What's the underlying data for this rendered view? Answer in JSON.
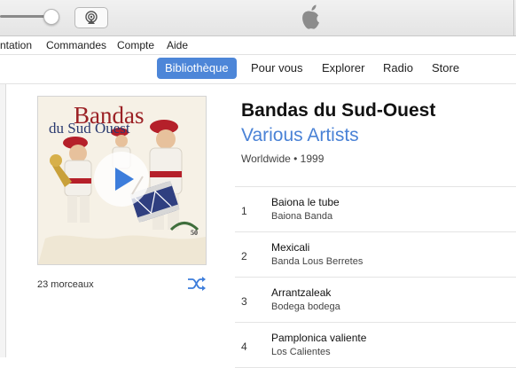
{
  "menu": {
    "items": [
      "ntation",
      "Commandes",
      "Compte",
      "Aide"
    ]
  },
  "nav": {
    "tabs": [
      "Bibliothèque",
      "Pour vous",
      "Explorer",
      "Radio",
      "Store"
    ],
    "active": "Bibliothèque"
  },
  "album": {
    "title": "Bandas du Sud-Ouest",
    "artist": "Various Artists",
    "meta": "Worldwide • 1999",
    "track_count": "23 morceaux",
    "cover_text": {
      "line1": "Bandas",
      "line2": "du Sud Ouest"
    }
  },
  "tracks": [
    {
      "num": "1",
      "name": "Baiona le tube",
      "artist": "Baiona Banda"
    },
    {
      "num": "2",
      "name": "Mexicali",
      "artist": "Banda Lous Berretes"
    },
    {
      "num": "3",
      "name": "Arrantzaleak",
      "artist": "Bodega bodega"
    },
    {
      "num": "4",
      "name": "Pamplonica valiente",
      "artist": "Los Calientes"
    }
  ],
  "colors": {
    "accent": "#4d86d8",
    "artist_link": "#4a82d6"
  },
  "icons": {
    "volume": "volume-slider-knob",
    "airplay": "airplay-icon",
    "apple": "apple-logo-icon",
    "play": "play-icon",
    "shuffle": "shuffle-icon"
  }
}
